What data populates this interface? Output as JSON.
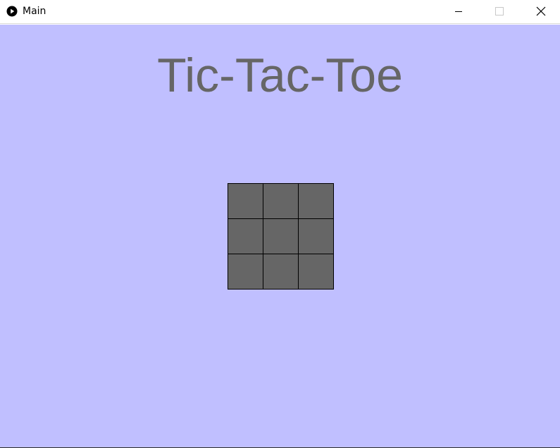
{
  "window": {
    "title": "Main",
    "app_icon": "play-circle-icon",
    "controls": {
      "minimize_icon": "minimize-icon",
      "maximize_icon": "maximize-icon",
      "close_icon": "close-icon"
    }
  },
  "game": {
    "title": "Tic-Tac-Toe",
    "background_color": "#c0bfff",
    "cell_color": "#666666",
    "board": [
      [
        "",
        "",
        ""
      ],
      [
        "",
        "",
        ""
      ],
      [
        "",
        "",
        ""
      ]
    ]
  }
}
